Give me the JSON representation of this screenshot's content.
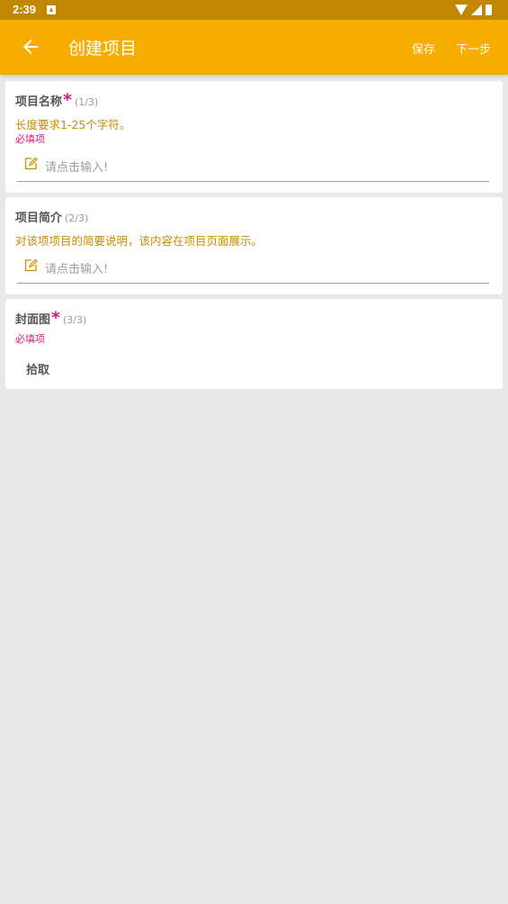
{
  "statusbar": {
    "time": "2:39"
  },
  "appbar": {
    "title": "创建项目",
    "save_label": "保存",
    "next_label": "下一步"
  },
  "fields": [
    {
      "title": "项目名称",
      "required_mark": "*",
      "step": "(1/3)",
      "hint": "长度要求1-25个字符。",
      "required_text": "必填项",
      "input_placeholder": "请点击输入!"
    },
    {
      "title": "项目简介",
      "step": "(2/3)",
      "hint": "对该项项目的简要说明，该内容在项目页面展示。",
      "input_placeholder": "请点击输入!"
    },
    {
      "title": "封面图",
      "required_mark": "*",
      "step": "(3/3)",
      "required_text": "必填项",
      "pick_label": "拾取"
    }
  ],
  "colors": {
    "appbar": "#f7ad00",
    "statusbar": "#c18700",
    "hint": "#c98b00",
    "required": "#d81b7a",
    "background": "#e8e8e8"
  }
}
